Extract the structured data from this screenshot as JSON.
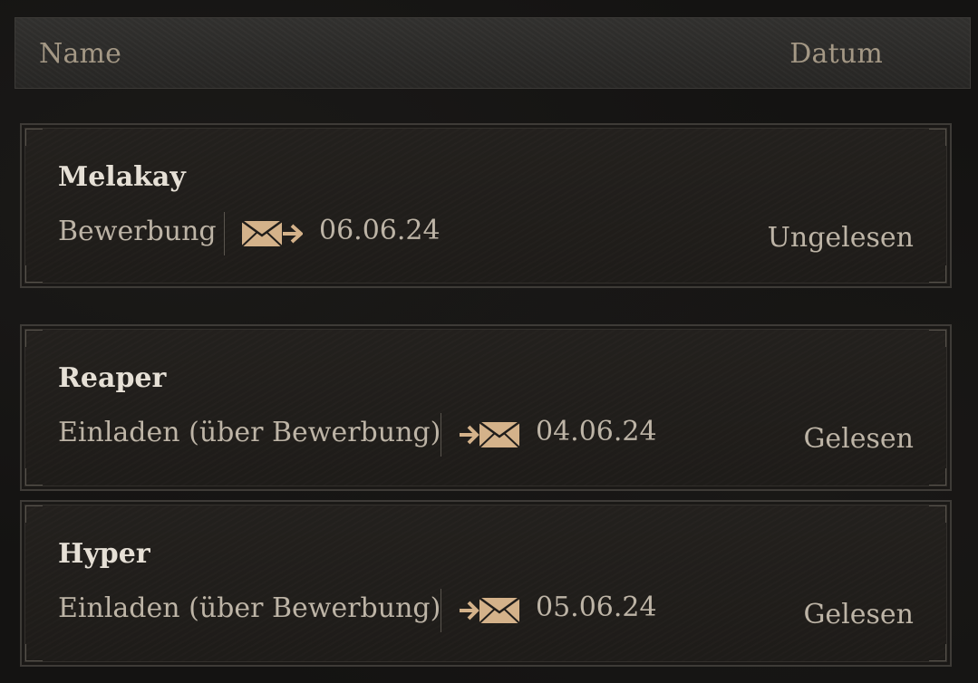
{
  "header": {
    "name_label": "Name",
    "date_label": "Datum"
  },
  "rows": [
    {
      "name": "Melakay",
      "type": "Bewerbung",
      "icon": "envelope-outgoing-icon",
      "date": "06.06.24",
      "status": "Ungelesen"
    },
    {
      "name": "Reaper",
      "type": "Einladen (über Bewerbung)",
      "icon": "envelope-incoming-icon",
      "date": "04.06.24",
      "status": "Gelesen"
    },
    {
      "name": "Hyper",
      "type": "Einladen (über Bewerbung)",
      "icon": "envelope-incoming-icon",
      "date": "05.06.24",
      "status": "Gelesen"
    }
  ],
  "colors": {
    "icon": "#d4b28a",
    "name_text": "#e6e0d6",
    "body_text": "#bdb4a6",
    "header_text": "#a49885"
  }
}
